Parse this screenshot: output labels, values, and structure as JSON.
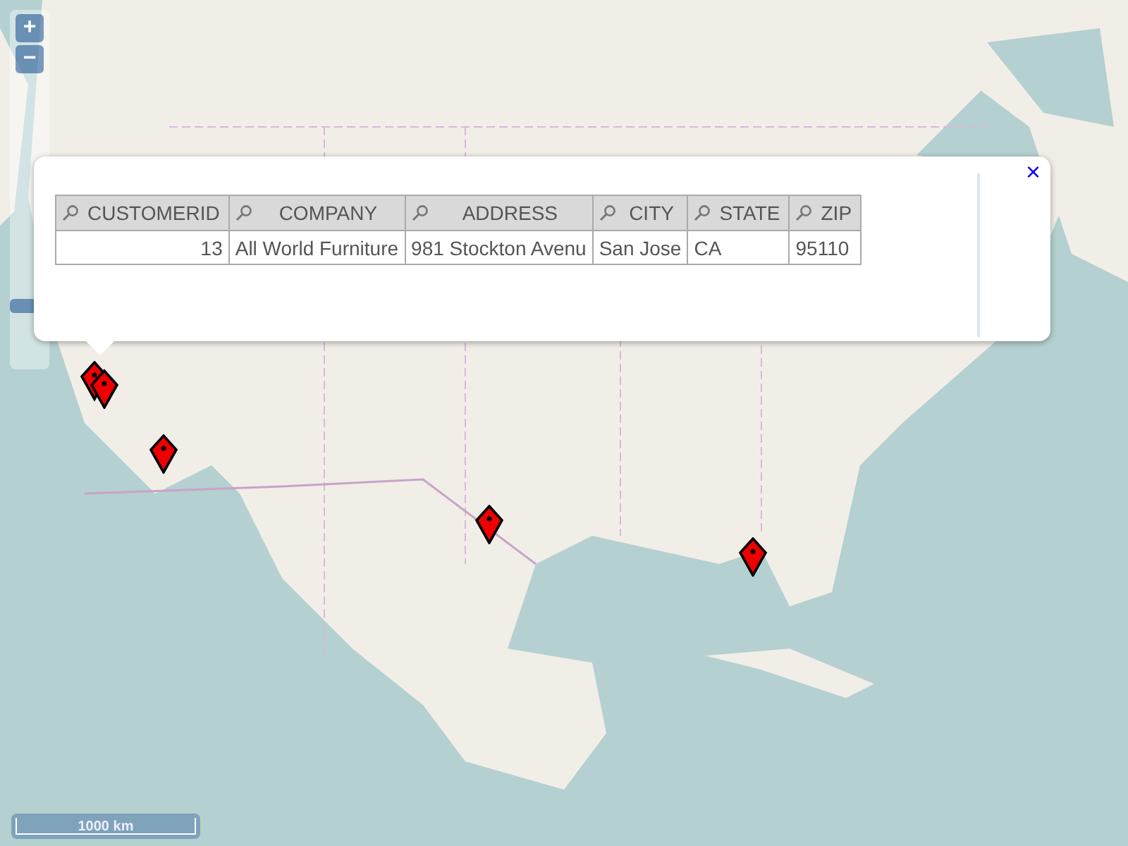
{
  "zoom": {
    "in_label": "+",
    "out_label": "−",
    "slider": {
      "level": 0.2
    }
  },
  "popup": {
    "close_label": "×",
    "columns": [
      {
        "label": "CUSTOMERID",
        "kind": "number"
      },
      {
        "label": "COMPANY",
        "kind": "text"
      },
      {
        "label": "ADDRESS",
        "kind": "text"
      },
      {
        "label": "CITY",
        "kind": "text"
      },
      {
        "label": "STATE",
        "kind": "text"
      },
      {
        "label": "ZIP",
        "kind": "text"
      }
    ],
    "rows": [
      [
        "13",
        "All World Furniture",
        "981 Stockton Avenu",
        "San Jose",
        "CA",
        "95110"
      ]
    ]
  },
  "scale_bar": {
    "label": "1000 km"
  }
}
